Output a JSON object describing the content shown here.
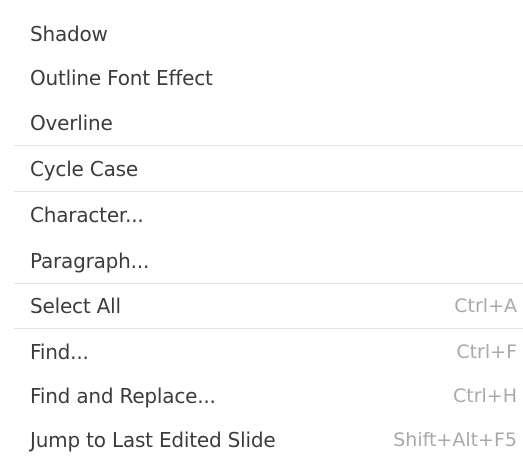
{
  "context_menu": {
    "items": [
      {
        "label": "Shadow",
        "shortcut": ""
      },
      {
        "label": "Outline Font Effect",
        "shortcut": ""
      },
      {
        "label": "Overline",
        "shortcut": ""
      },
      {
        "label": "Cycle Case",
        "shortcut": ""
      },
      {
        "label": "Character...",
        "shortcut": ""
      },
      {
        "label": "Paragraph...",
        "shortcut": ""
      },
      {
        "label": "Select All",
        "shortcut": "Ctrl+A"
      },
      {
        "label": "Find...",
        "shortcut": "Ctrl+F"
      },
      {
        "label": "Find and Replace...",
        "shortcut": "Ctrl+H"
      },
      {
        "label": "Jump to Last Edited Slide",
        "shortcut": "Shift+Alt+F5"
      }
    ]
  }
}
